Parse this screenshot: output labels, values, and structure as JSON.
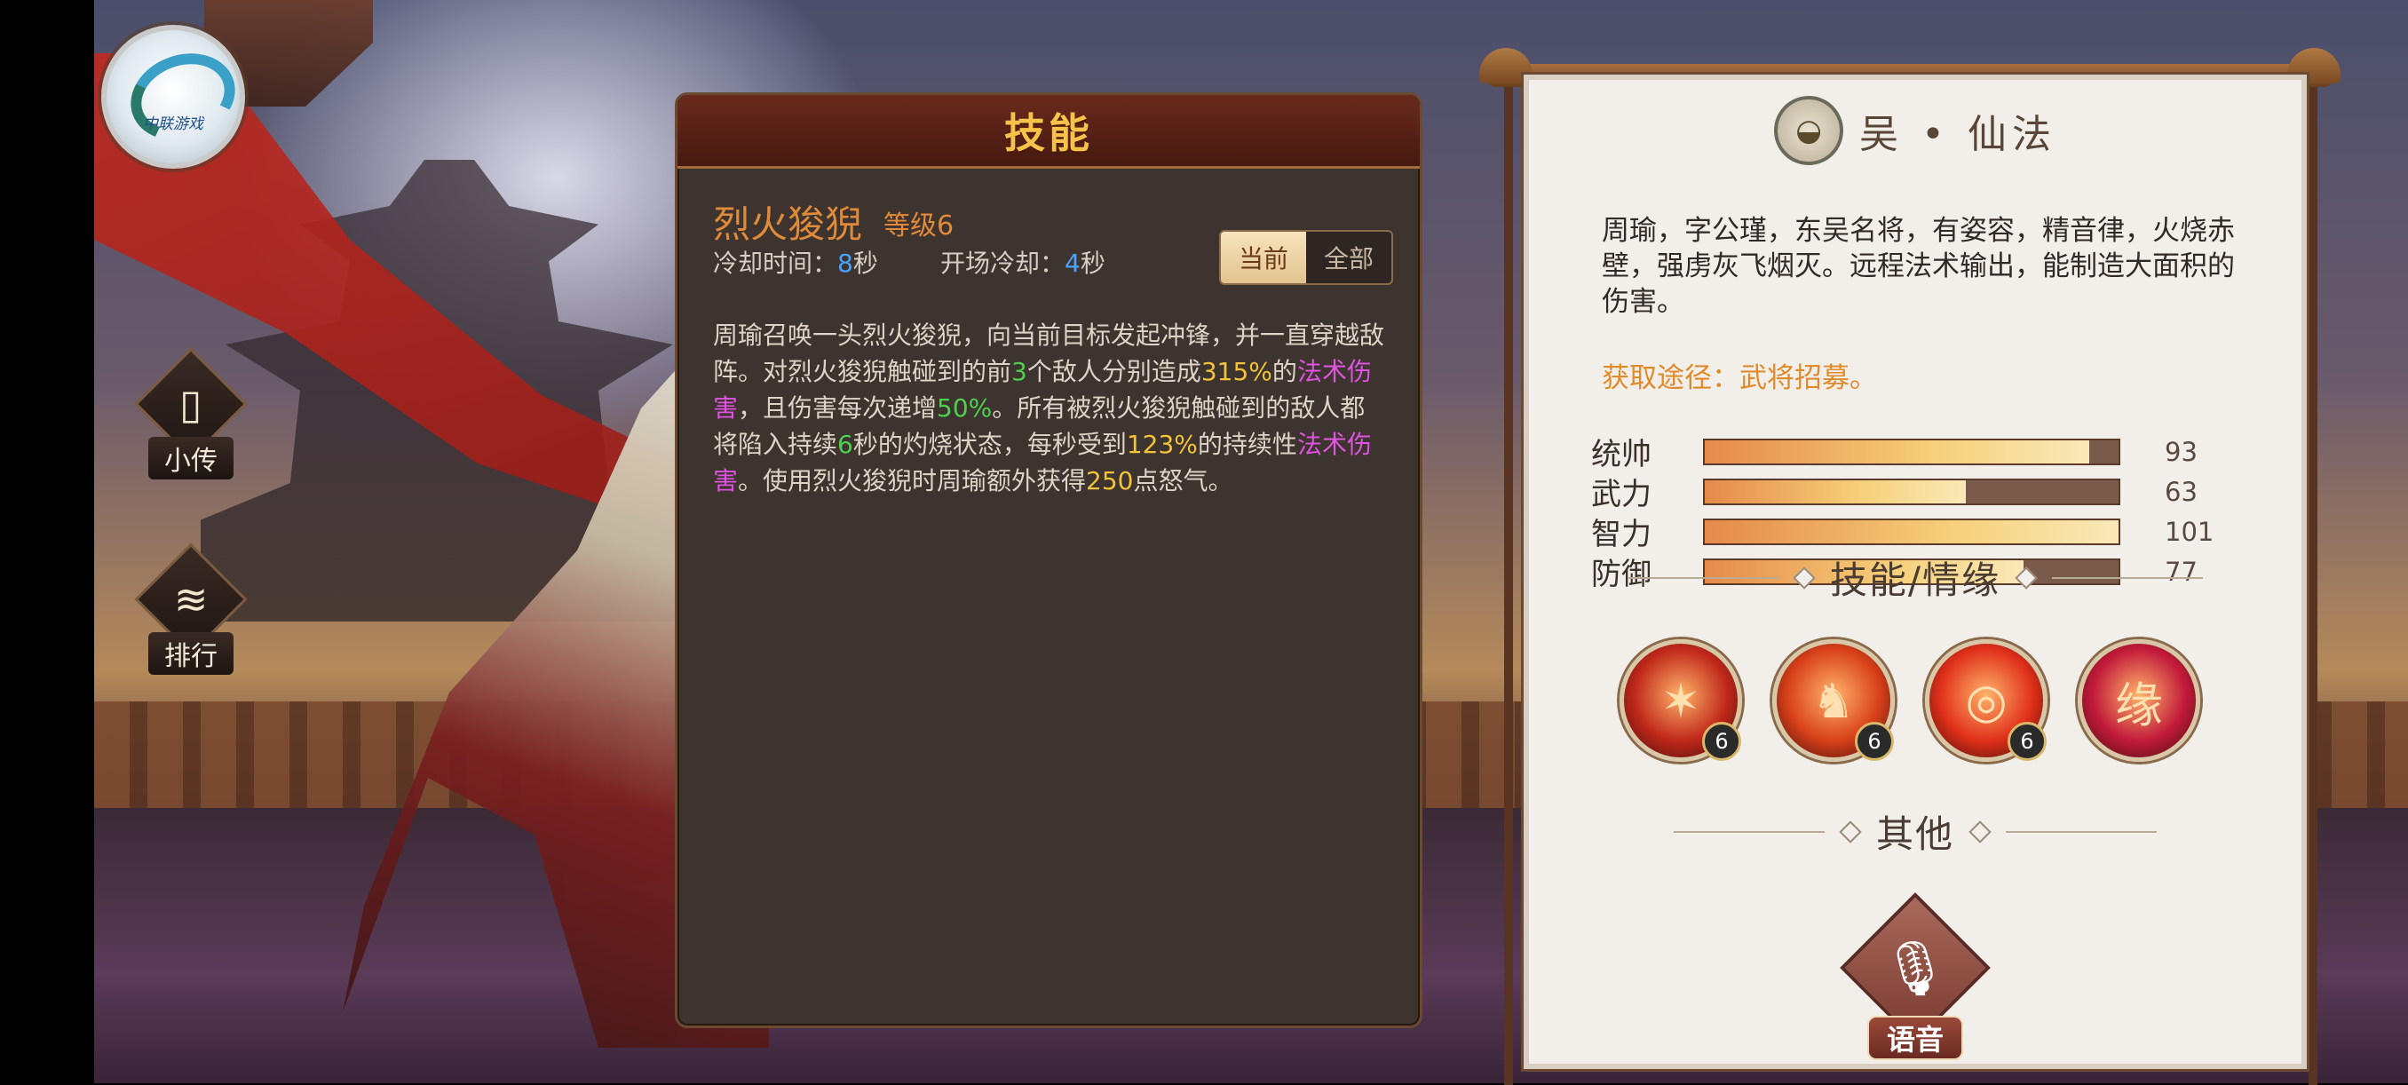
{
  "logo": {
    "text": "中联游戏"
  },
  "side_menu": [
    {
      "label": "小传",
      "icon": "cards-icon"
    },
    {
      "label": "排行",
      "icon": "scroll-icon"
    }
  ],
  "skill_panel": {
    "title": "技能",
    "skill_name": "烈火狻猊",
    "level_text": "等级6",
    "cooldown_label": "冷却时间：",
    "cooldown_value": "8",
    "cooldown_unit": "秒",
    "opening_cd_label": "开场冷却：",
    "opening_cd_value": "4",
    "opening_cd_unit": "秒",
    "toggle_current": "当前",
    "toggle_all": "全部",
    "desc": {
      "p1": "周瑜召唤一头烈火狻猊，向当前目标发起冲锋，并一直穿越敌阵。对烈火狻猊触碰到的前",
      "n_targets": "3",
      "p2": "个敌人分别造成",
      "pct1": "315%",
      "p3": "的",
      "dmg1": "法术伤害",
      "p4": "，且伤害每次递增",
      "pct2": "50%",
      "p5": "。所有被烈火狻猊触碰到的敌人都将陷入持续",
      "burn_sec": "6",
      "p6": "秒的灼烧状态，每秒受到",
      "pct3": "123%",
      "p7": "的持续性",
      "dmg2": "法术伤害",
      "p8": "。使用烈火狻猊时周瑜额外获得",
      "rage": "250",
      "p9": "点怒气。"
    }
  },
  "info_panel": {
    "faction": "吴 • 仙法",
    "bio": "周瑜，字公瑾，东吴名将，有姿容，精音律，火烧赤壁，强虏灰飞烟灭。远程法术输出，能制造大面积的伤害。",
    "source": "获取途径：武将招募。",
    "stats": [
      {
        "name": "统帅",
        "value": "93",
        "fill": 0.93
      },
      {
        "name": "武力",
        "value": "63",
        "fill": 0.63
      },
      {
        "name": "智力",
        "value": "101",
        "fill": 1.0
      },
      {
        "name": "防御",
        "value": "77",
        "fill": 0.77
      }
    ],
    "skills_title": "技能/情缘",
    "skills": [
      {
        "icon": "fire-slash-icon",
        "level": "6",
        "color": "#c0281a"
      },
      {
        "icon": "fire-beast-icon",
        "level": "6",
        "color": "#d8401a"
      },
      {
        "icon": "fire-ring-icon",
        "level": "6",
        "color": "#e0301a"
      },
      {
        "icon": "fate-heart-icon",
        "glyph": "缘",
        "color": "#c21a3a"
      }
    ],
    "other_title": "其他",
    "voice_label": "语音"
  }
}
